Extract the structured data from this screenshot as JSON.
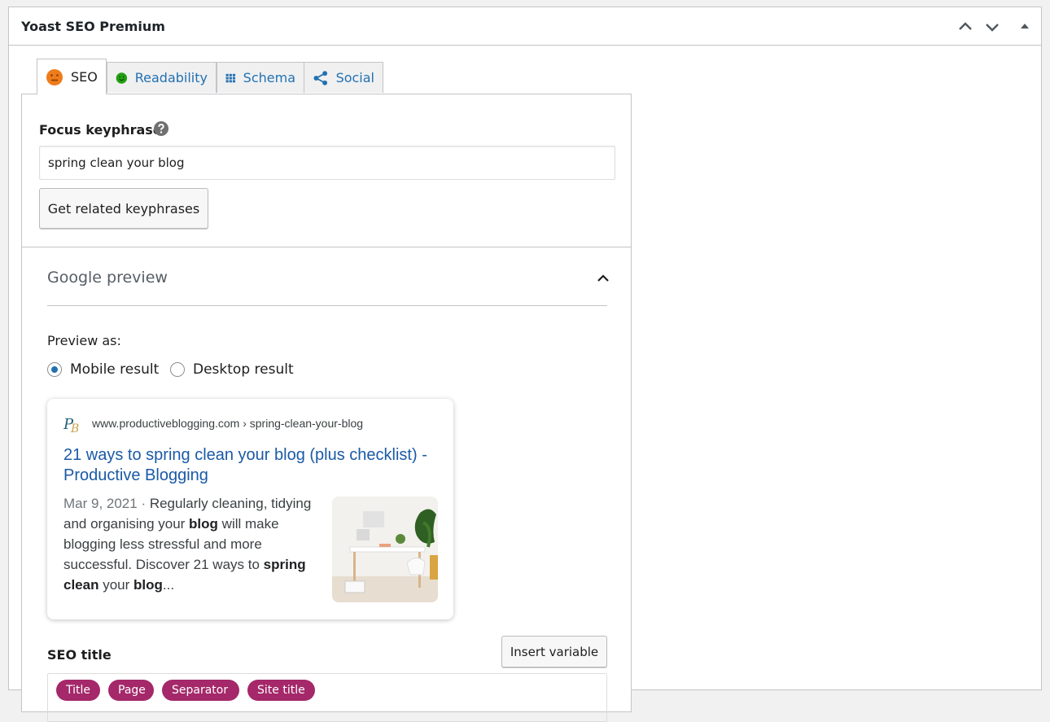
{
  "panel": {
    "title": "Yoast SEO Premium"
  },
  "tabs": [
    {
      "label": "SEO",
      "icon": "orange-neutral-face-icon",
      "color": "#ee7c1b"
    },
    {
      "label": "Readability",
      "icon": "green-smiley-face-icon",
      "color": "#7ad03a"
    },
    {
      "label": "Schema",
      "icon": "grid-icon",
      "color": "#2271b1"
    },
    {
      "label": "Social",
      "icon": "share-icon",
      "color": "#2271b1"
    }
  ],
  "focus": {
    "label": "Focus keyphrase",
    "value": "spring clean your blog",
    "related_button": "Get related keyphrases"
  },
  "google_preview": {
    "title": "Google preview",
    "preview_as_label": "Preview as:",
    "options": [
      "Mobile result",
      "Desktop result"
    ],
    "selected": "Mobile result"
  },
  "serp": {
    "url": "www.productiveblogging.com › spring-clean-your-blog",
    "title": "21 ways to spring clean your blog (plus checklist) - Productive Blogging",
    "date": "Mar 9, 2021 · ",
    "desc_parts": [
      {
        "text": "Regularly cleaning, tidying and organising your ",
        "bold": false
      },
      {
        "text": "blog",
        "bold": true
      },
      {
        "text": " will make blogging less stressful and more successful. Discover 21 ways to ",
        "bold": false
      },
      {
        "text": "spring clean",
        "bold": true
      },
      {
        "text": " your ",
        "bold": false
      },
      {
        "text": "blog",
        "bold": true
      },
      {
        "text": "...",
        "bold": false
      }
    ]
  },
  "seo_title": {
    "label": "SEO title",
    "insert_button": "Insert variable",
    "pills": [
      "Title",
      "Page",
      "Separator",
      "Site title"
    ]
  },
  "colors": {
    "accent": "#2271b1",
    "pill": "#a4286a",
    "serp_link": "#1a5aa6"
  }
}
